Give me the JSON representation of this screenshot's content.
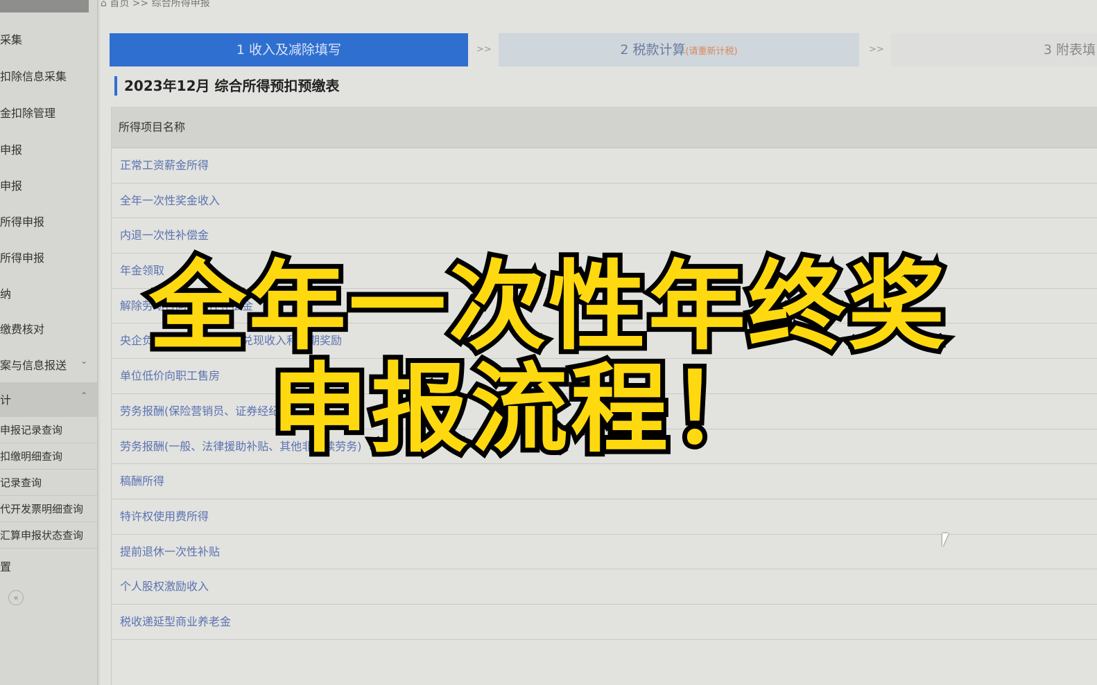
{
  "breadcrumb": "首页 >> 综合所得申报",
  "sidebar": {
    "items": [
      "采集",
      "扣除信息采集",
      "金扣除管理",
      "申报",
      "申报",
      "所得申报",
      "所得申报",
      "纳",
      "缴费核对",
      "案与信息报送"
    ],
    "group": "计",
    "subitems": [
      "申报记录查询",
      "扣缴明细查询",
      "记录查询",
      "代开发票明细查询",
      "汇算申报状态查询"
    ],
    "settings": "置",
    "collapse": "«"
  },
  "steps": [
    {
      "label": "1 收入及减除填写"
    },
    {
      "label": "2 税款计算",
      "hint": "(请重新计税)"
    },
    {
      "label": "3 附表填"
    }
  ],
  "step_sep": ">>",
  "accent": "#2f6fd0",
  "section_title": "2023年12月  综合所得预扣预缴表",
  "table": {
    "header": "所得项目名称",
    "rows": [
      "正常工资薪金所得",
      "全年一次性奖金收入",
      "内退一次性补偿金",
      "年金领取",
      "解除劳动合同一次性补偿金",
      "央企负责人绩效薪金延期兑现收入和任期奖励",
      "单位低价向职工售房",
      "劳务报酬(保险营销员、证券经纪人)",
      "劳务报酬(一般、法律援助补贴、其他非连续劳务)",
      "稿酬所得",
      "特许权使用费所得",
      "提前退休一次性补贴",
      "个人股权激励收入",
      "税收递延型商业养老金"
    ]
  },
  "overlay": {
    "line1": "全年一次性年终奖",
    "line2": "申报流程！",
    "color": "#ffd90f"
  }
}
